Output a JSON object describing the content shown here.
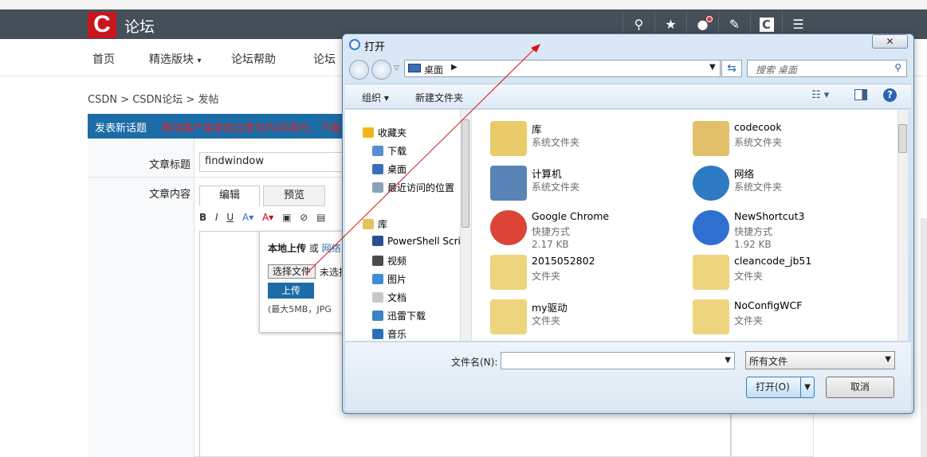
{
  "page": {
    "brand": "论坛",
    "header_icons": [
      "search-icon",
      "star-icon",
      "bell-icon",
      "edit-icon",
      "csdn-c-icon",
      "menu-icon"
    ],
    "nav": [
      "首页",
      "精选版块",
      "论坛帮助",
      "论坛"
    ],
    "nav_dropdown_glyph": "▾",
    "breadcrumb": "CSDN > CSDN论坛 > 发帖",
    "post_title": "发表新话题",
    "notice": "移动客户端发帖立即50%可用分，下载",
    "label_title": "文章标题",
    "title_value": "findwindow",
    "label_content": "文章内容",
    "tab_edit": "编辑",
    "tab_preview": "预览",
    "toolbar": [
      "B",
      "I",
      "U",
      "A▾",
      "A▾",
      "▣",
      "⊘",
      "▤"
    ],
    "upload": {
      "heading": "本地上传",
      "or": " 或 ",
      "network": "网络",
      "choose": "选择文件",
      "nofile": "未选择",
      "upload_btn": "上传",
      "hint": "(最大5MB，JPG"
    }
  },
  "dialog": {
    "title": "打开",
    "close": "✕",
    "address": "桌面",
    "search_placeholder": "搜索 桌面",
    "organize": "组织 ▾",
    "new_folder": "新建文件夹",
    "nav_tree": [
      {
        "label": "收藏夹",
        "icon": "star-icon",
        "color": "#f2b51d"
      },
      {
        "label": "下载",
        "icon": "download-icon",
        "color": "#5b8bd0"
      },
      {
        "label": "桌面",
        "icon": "desktop-icon",
        "color": "#3a6fb6"
      },
      {
        "label": "最近访问的位置",
        "icon": "recent-icon",
        "color": "#8aa2ba"
      },
      {
        "label": "库",
        "icon": "library-icon",
        "color": "#e8c15a"
      },
      {
        "label": "PowerShell Scri",
        "icon": "powershell-icon",
        "color": "#2a4f8c"
      },
      {
        "label": "视频",
        "icon": "video-icon",
        "color": "#4b4b4b"
      },
      {
        "label": "图片",
        "icon": "picture-icon",
        "color": "#3f8bd6"
      },
      {
        "label": "文档",
        "icon": "document-icon",
        "color": "#c8c8c8"
      },
      {
        "label": "迅雷下载",
        "icon": "thunder-icon",
        "color": "#3b82c4"
      },
      {
        "label": "音乐",
        "icon": "music-icon",
        "color": "#2d6fb7"
      }
    ],
    "files": [
      {
        "name": "库",
        "type": "系统文件夹",
        "size": "",
        "icon": "library-folder-icon",
        "color": "#eacb6c"
      },
      {
        "name": "codecook",
        "type": "系统文件夹",
        "size": "",
        "icon": "user-folder-icon",
        "color": "#e2c06a"
      },
      {
        "name": "计算机",
        "type": "系统文件夹",
        "size": "",
        "icon": "computer-icon",
        "color": "#5a84b8"
      },
      {
        "name": "网络",
        "type": "系统文件夹",
        "size": "",
        "icon": "network-icon",
        "color": "#2e7bc4"
      },
      {
        "name": "Google Chrome",
        "type": "快捷方式",
        "size": "2.17 KB",
        "icon": "chrome-icon",
        "color": "#db4437"
      },
      {
        "name": "NewShortcut3",
        "type": "快捷方式",
        "size": "1.92 KB",
        "icon": "shortcut-icon",
        "color": "#2f6fd0"
      },
      {
        "name": "2015052802",
        "type": "文件夹",
        "size": "",
        "icon": "folder-icon",
        "color": "#eed47e"
      },
      {
        "name": "cleancode_jb51",
        "type": "文件夹",
        "size": "",
        "icon": "folder-icon",
        "color": "#eed47e"
      },
      {
        "name": "my驱动",
        "type": "文件夹",
        "size": "",
        "icon": "folder-icon",
        "color": "#eed47e"
      },
      {
        "name": "NoConfigWCF",
        "type": "文件夹",
        "size": "",
        "icon": "folder-icon",
        "color": "#eed47e"
      }
    ],
    "filename_label": "文件名(N):",
    "filename_value": "",
    "filetype": "所有文件",
    "open_btn": "打开(O)",
    "cancel_btn": "取消"
  }
}
